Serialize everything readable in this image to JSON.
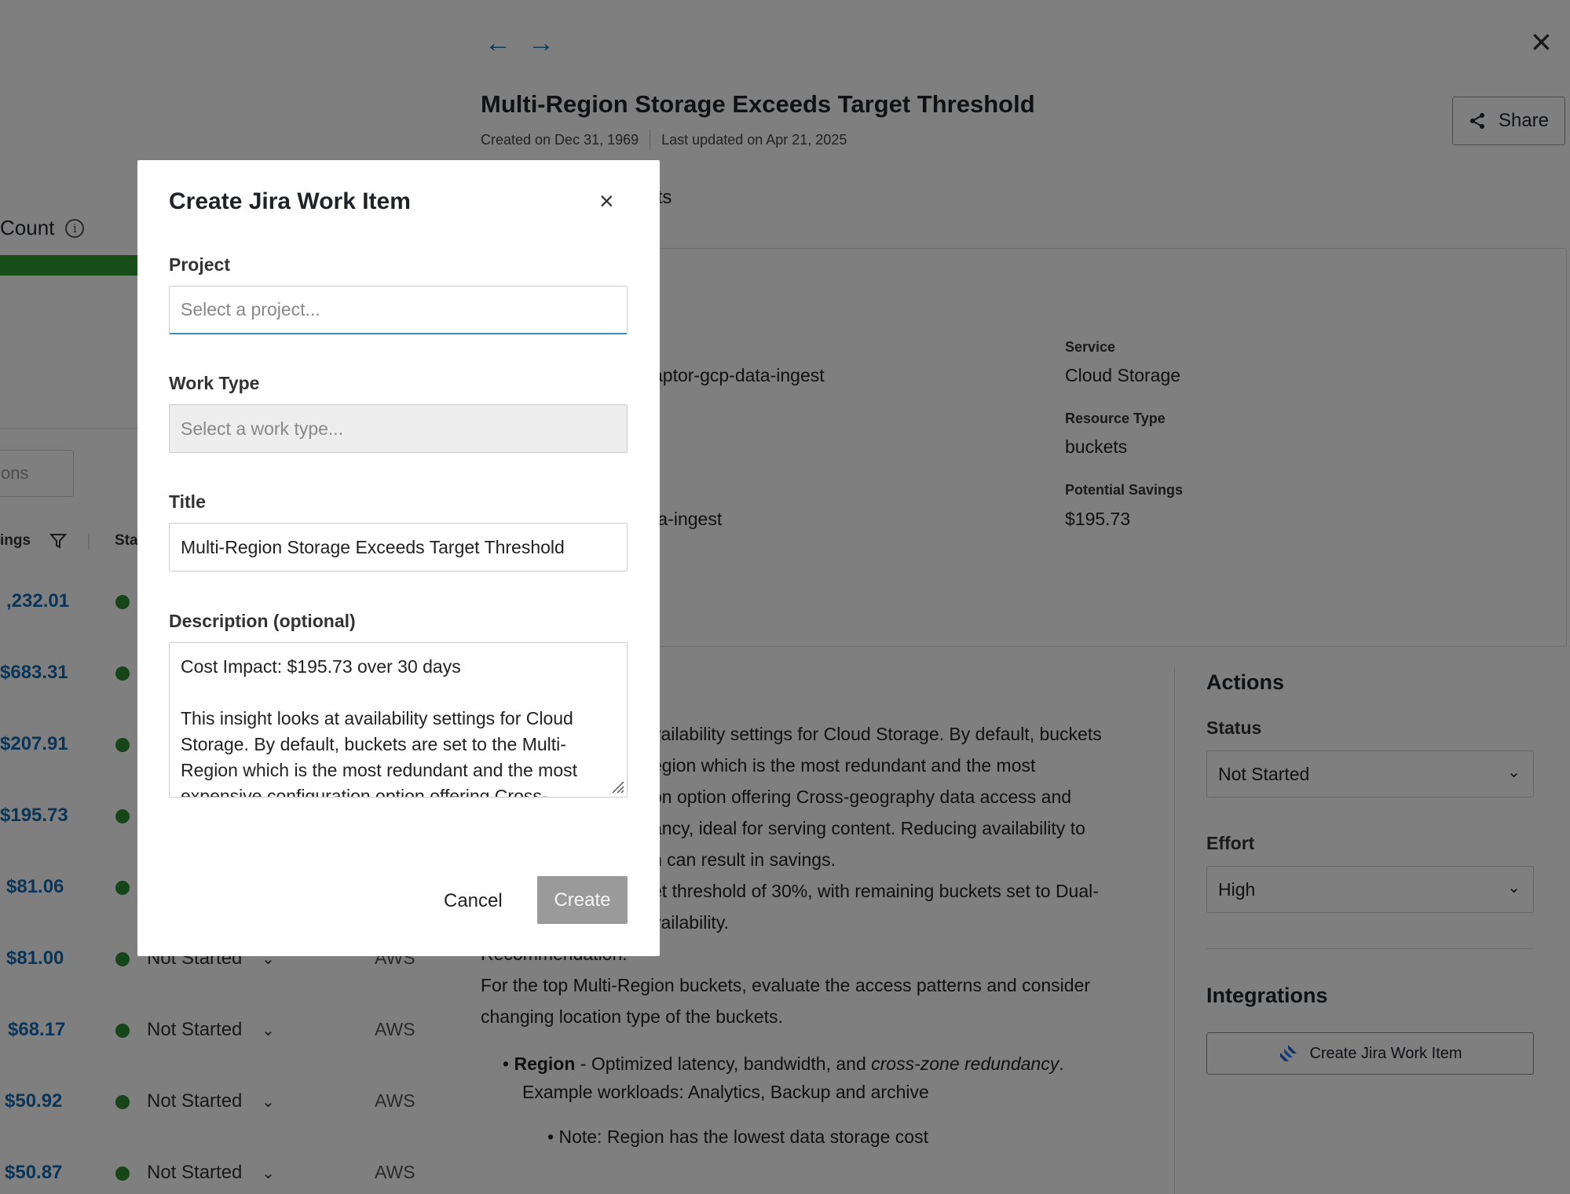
{
  "background_list": {
    "count_label": "Count",
    "search_placeholder": "ons",
    "col_savings": "ings",
    "col_status": "Sta",
    "rows": [
      {
        "amount": ",232.01",
        "status": "",
        "provider": ""
      },
      {
        "amount": "$683.31",
        "status": "",
        "provider": ""
      },
      {
        "amount": "$207.91",
        "status": "",
        "provider": ""
      },
      {
        "amount": "$195.73",
        "status": "",
        "provider": ""
      },
      {
        "amount": "$81.06",
        "status": "",
        "provider": ""
      },
      {
        "amount": "$81.00",
        "status": "Not Started",
        "provider": "AWS"
      },
      {
        "amount": "$68.17",
        "status": "Not Started",
        "provider": "AWS"
      },
      {
        "amount": "$50.92",
        "status": "Not Started",
        "provider": "AWS"
      },
      {
        "amount": "$50.87",
        "status": "Not Started",
        "provider": "AWS"
      }
    ]
  },
  "detail": {
    "title": "Multi-Region Storage Exceeds Target Threshold",
    "created": "Created on Dec 31, 1969",
    "updated": "Last updated on Apr 21, 2025",
    "share_label": "Share",
    "tab_partial": "ents",
    "fields": {
      "project_partial": "aptor-gcp-data-ingest",
      "account_partial": "ta-ingest",
      "service_label": "Service",
      "service_value": "Cloud Storage",
      "resource_type_label": "Resource Type",
      "resource_type_value": "buckets",
      "potential_savings_label": "Potential Savings",
      "potential_savings_value": "$195.73"
    },
    "description_lines": [
      "vailability settings for Cloud Storage. By default, buckets",
      "egion which is the most redundant and the most",
      "on option offering Cross-geography data access and",
      "ancy, ideal for serving content. Reducing availability to",
      "n can result in savings.",
      "et threshold of 30%, with remaining buckets set to Dual-",
      "vailability.",
      "Recommendation:",
      "For the top Multi-Region buckets, evaluate the access patterns and consider",
      "changing location type of the buckets."
    ],
    "bullet": {
      "bold": "Region",
      "text1": " - Optimized latency, bandwidth, and ",
      "italic": "cross-zone redundancy",
      "text2": ".",
      "line2": "Example workloads: Analytics, Backup and archive",
      "sub_bullet": "Note: Region has the lowest data storage cost"
    },
    "actions": {
      "title": "Actions",
      "status_label": "Status",
      "status_value": "Not Started",
      "effort_label": "Effort",
      "effort_value": "High"
    },
    "integrations": {
      "title": "Integrations",
      "jira_button": "Create Jira Work Item"
    }
  },
  "modal": {
    "title": "Create Jira Work Item",
    "project_label": "Project",
    "project_placeholder": "Select a project...",
    "work_type_label": "Work Type",
    "work_type_placeholder": "Select a work type...",
    "title_label": "Title",
    "title_value": "Multi-Region Storage Exceeds Target Threshold",
    "description_label": "Description (optional)",
    "description_value": "Cost Impact: $195.73 over 30 days\n\nThis insight looks at availability settings for Cloud Storage. By default, buckets are set to the Multi-Region which is the most redundant and the most expensive configuration option offering Cross-",
    "cancel_label": "Cancel",
    "create_label": "Create"
  },
  "colors": {
    "accent_blue": "#176bb0",
    "status_green": "#2a8d2e",
    "disabled_button": "#9a9a9a",
    "jira_blue": "#1b66c9"
  }
}
